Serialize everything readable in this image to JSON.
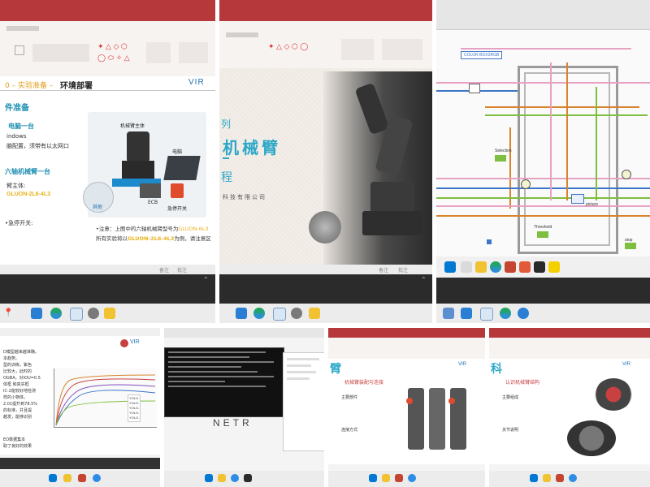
{
  "tile1": {
    "title_prefix": "0 – 实验准备 –",
    "title_main": "环境部署",
    "brand": "VIR",
    "section": "件准备",
    "item1_head": "电脑一台",
    "item1_line1": "indows",
    "item1_line2": "脑配置，须带有以太网口",
    "item2_head": "六轴机械臂一台",
    "item2_line1": "臂主体:",
    "item2_model": "GLUON-2L6-4L3",
    "item3": "•急停开关:",
    "photo_label_arm": "机械臂主体",
    "photo_label_pc": "电脑",
    "photo_label_ecb": "ECB",
    "photo_label_estop": "急停开关",
    "photo_label_cable": "其他",
    "note_line1_a": "•注意：上图中的六轴机械臂型号为",
    "note_line1_b": "GLUON-6L3",
    "note_line2_a": "所有实验将以",
    "note_line2_b": "GLUON-2L6-4L3",
    "note_line2_c": "为例，请注意区",
    "status_note": "备注",
    "status_comment": "批注"
  },
  "tile2": {
    "title_left": "列",
    "title_big": "机械臂",
    "subtitle": "程",
    "company": "科技有限公司",
    "status_note": "备注",
    "status_comment": "批注"
  },
  "tile3": {
    "label_color": "COLOR BOX2RGB",
    "label_threshold": "Threshold",
    "label_stop": "stop",
    "label_picture": "picture",
    "label_selection": "Selection"
  },
  "tile4": {
    "brand": "VIR",
    "text_lines": [
      "D模型越来越准确，",
      "本趋势。",
      "型的训练，紫色",
      "比较大，此时的",
      "OGBA，对IOU=0.5",
      "体框 和真实框",
      "IC-2能较好地检测",
      "样的小物体。",
      "2.01提升到78.5%",
      "的标准，并且提",
      "越发，能够识别"
    ],
    "legend": [
      "YOLO-",
      "YOLO-",
      "YOLO-",
      "YOLO-",
      "YOLO-"
    ],
    "bottom_lines": [
      "EO数据集本",
      "取了良好的效果"
    ]
  },
  "tile5": {
    "banner": "NETR"
  },
  "tile6": {
    "title": "臂",
    "brand": "VIR",
    "heading": "机械臂装配与连接",
    "bullet1": "主要部件",
    "bullet2": "连接方式"
  },
  "tile7": {
    "title": "科",
    "brand": "VIR",
    "heading": "认识机械臂结构",
    "bullet1": "主要组成",
    "bullet2": "关节说明"
  },
  "colors": {
    "ppt_red": "#b6383a",
    "taskbar": "#2b2b2b",
    "title_blue": "#1f6fb2",
    "highlight_yellow": "#e8b21c",
    "labview_pink": "#e7a1c2",
    "labview_orange": "#d9832c",
    "labview_green": "#7fbf3f",
    "labview_blue": "#3d76c9"
  }
}
